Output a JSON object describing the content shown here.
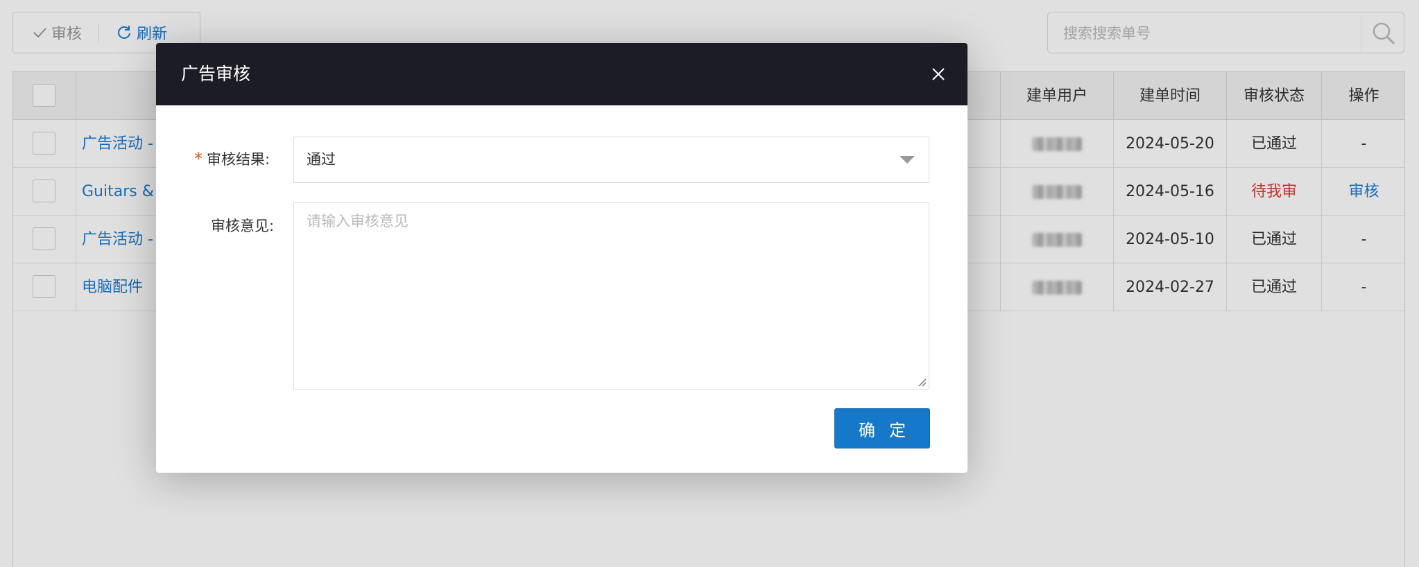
{
  "toolbar": {
    "audit_label": "审核",
    "refresh_label": "刷新"
  },
  "search": {
    "placeholder": "搜索搜索单号"
  },
  "table": {
    "columns": [
      "建单用户",
      "建单时间",
      "审核状态",
      "操作"
    ],
    "rows": [
      {
        "title": "广告活动 -",
        "date": "2024-05-20",
        "status": "已通过",
        "action": "-"
      },
      {
        "title": "Guitars & C",
        "date": "2024-05-16",
        "status": "待我审",
        "action": "审核"
      },
      {
        "title": "广告活动 -",
        "date": "2024-05-10",
        "status": "已通过",
        "action": "-"
      },
      {
        "title": "电脑配件",
        "date": "2024-02-27",
        "status": "已通过",
        "action": "-"
      }
    ]
  },
  "modal": {
    "title": "广告审核",
    "required_mark": "*",
    "result_label": "审核结果:",
    "result_value": "通过",
    "comment_label": "审核意见:",
    "comment_placeholder": "请输入审核意见",
    "confirm_label": "确定"
  },
  "colors": {
    "link": "#1a7ad4",
    "pending": "#e03b2e",
    "header_dark": "#1c1c26",
    "primary_button": "#1678c8",
    "required": "#e64a19"
  },
  "icons": [
    "check-icon",
    "refresh-icon",
    "search-icon",
    "close-icon",
    "caret-down-icon",
    "resize-grip-icon"
  ]
}
